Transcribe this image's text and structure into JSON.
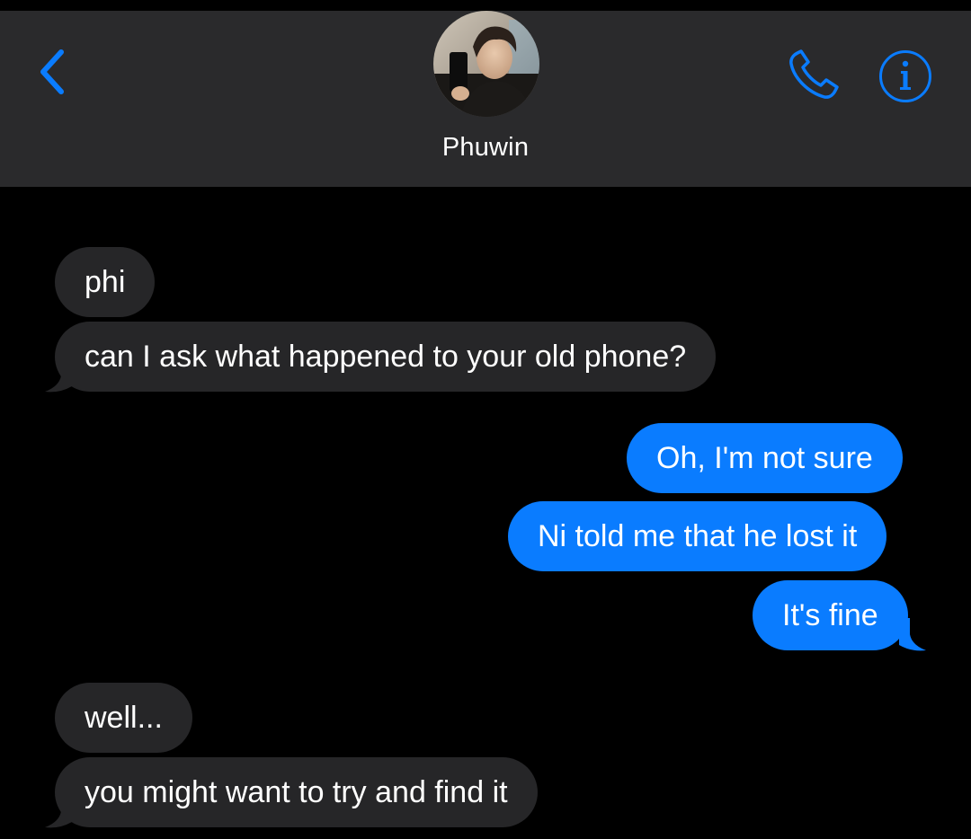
{
  "header": {
    "contact_name": "Phuwin",
    "back_icon": "chevron-left-icon",
    "call_icon": "phone-icon",
    "info_icon": "info-icon",
    "accent_color": "#0a7cff"
  },
  "messages": [
    {
      "direction": "incoming",
      "text": "phi"
    },
    {
      "direction": "incoming",
      "text": "can I ask what happened to your old phone?"
    },
    {
      "direction": "outgoing",
      "text": "Oh, I'm not sure"
    },
    {
      "direction": "outgoing",
      "text": "Ni told me that he lost it"
    },
    {
      "direction": "outgoing",
      "text": "It's fine"
    },
    {
      "direction": "incoming",
      "text": "well..."
    },
    {
      "direction": "incoming",
      "text": "you might want to try and find it"
    }
  ],
  "colors": {
    "header_background": "#2a2a2c",
    "incoming_bubble": "#262628",
    "outgoing_bubble": "#0a7cff",
    "background": "#000000"
  }
}
